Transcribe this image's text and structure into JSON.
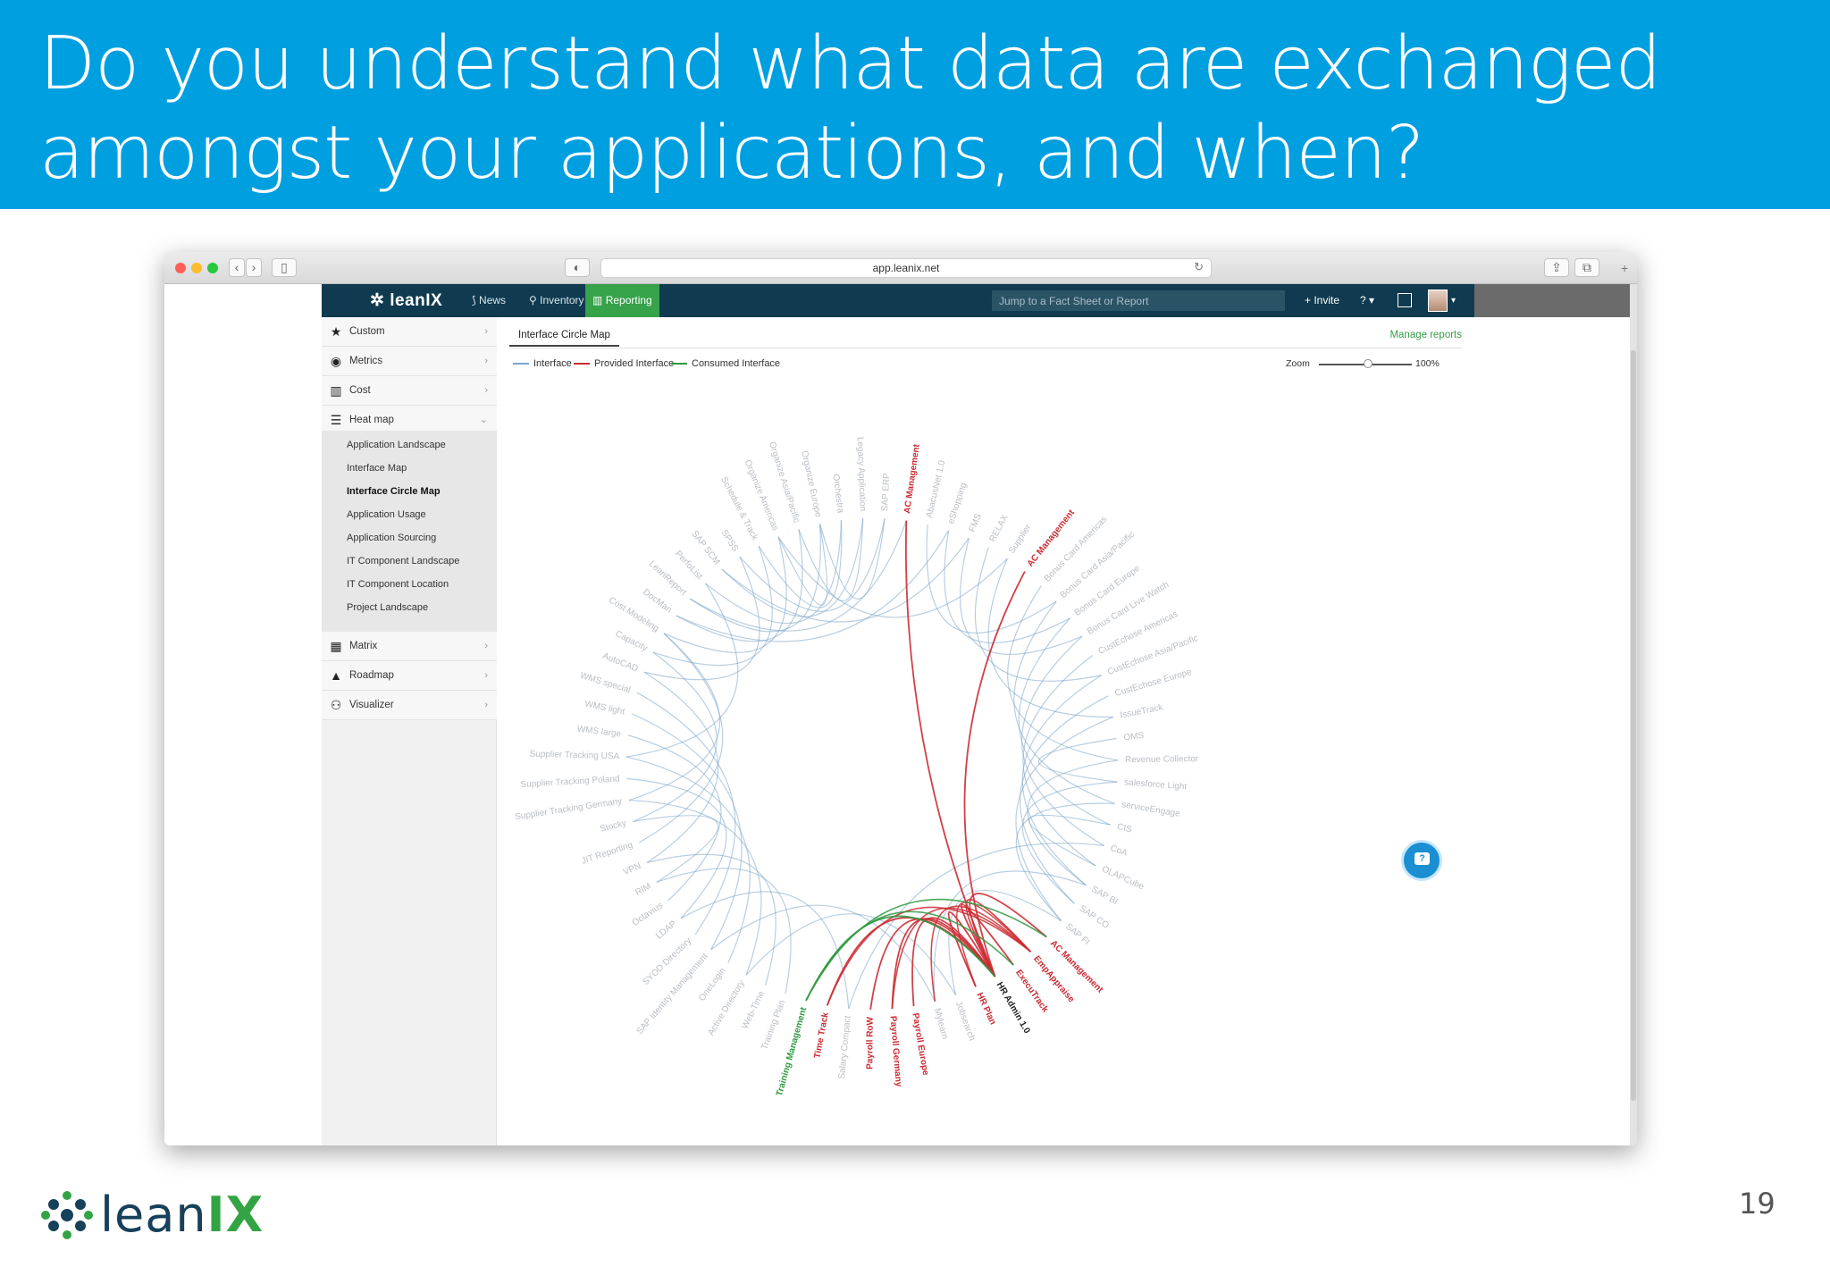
{
  "slide": {
    "title": "Do you understand what data are exchanged amongst your applications, and when?",
    "page_number": "19",
    "footer_logo_text_main": "lean",
    "footer_logo_text_accent": "IX"
  },
  "browser": {
    "url": "app.leanix.net"
  },
  "app": {
    "logo": "leanIX",
    "nav": [
      {
        "label": "News",
        "icon": "rss-icon"
      },
      {
        "label": "Inventory",
        "icon": "search-icon"
      },
      {
        "label": "Reporting",
        "icon": "bar-chart-icon",
        "active": true
      }
    ],
    "jump_placeholder": "Jump to a Fact Sheet or Report",
    "invite_label": "+ Invite",
    "help_label": "?",
    "colors": {
      "nav_bg": "#0f3a4f",
      "active_green": "#36a24a",
      "provided": "#cc2b33",
      "consumed": "#2e9a40",
      "interface": "#7ea6c9"
    }
  },
  "sidebar": {
    "items": [
      {
        "label": "Custom",
        "icon": "star-icon"
      },
      {
        "label": "Metrics",
        "icon": "dashboard-icon"
      },
      {
        "label": "Cost",
        "icon": "bar-chart-icon"
      },
      {
        "label": "Heat map",
        "icon": "list-icon",
        "expanded": true
      },
      {
        "label": "Matrix",
        "icon": "grid-icon"
      },
      {
        "label": "Roadmap",
        "icon": "roadmap-icon"
      },
      {
        "label": "Visualizer",
        "icon": "hierarchy-icon"
      }
    ],
    "heat_map_sub": [
      "Application Landscape",
      "Interface Map",
      "Interface Circle Map",
      "Application Usage",
      "Application Sourcing",
      "IT Component Landscape",
      "IT Component Location",
      "Project Landscape"
    ],
    "selected_sub": "Interface Circle Map"
  },
  "report": {
    "tab_label": "Interface Circle Map",
    "manage_reports": "Manage reports",
    "legend": [
      {
        "label": "Interface",
        "color": "#7ea6c9"
      },
      {
        "label": "Provided Interface",
        "color": "#cc2b33"
      },
      {
        "label": "Consumed Interface",
        "color": "#2e9a40"
      }
    ],
    "zoom_label": "Zoom",
    "zoom_value": "100%",
    "zoom_level": 0.5
  },
  "circle_map": {
    "labels": [
      {
        "text": "AC Management",
        "style": "red"
      },
      {
        "text": "AbacusNet 1.0",
        "style": "faint"
      },
      {
        "text": "eShopping",
        "style": "faint"
      },
      {
        "text": "FMS",
        "style": "faint"
      },
      {
        "text": "RELAX",
        "style": "faint"
      },
      {
        "text": "Supplier",
        "style": "faint"
      },
      {
        "text": "AC Management",
        "style": "red"
      },
      {
        "text": "Bonus Card Americas",
        "style": "faint"
      },
      {
        "text": "Bonus Card Asia/Pacific",
        "style": "faint"
      },
      {
        "text": "Bonus Card Europe",
        "style": "faint"
      },
      {
        "text": "Bonus Card Live Watch",
        "style": "faint"
      },
      {
        "text": "CustEchose Americas",
        "style": "faint"
      },
      {
        "text": "CustEchose Asia/Pacific",
        "style": "faint"
      },
      {
        "text": "CustEchose Europe",
        "style": "faint"
      },
      {
        "text": "IssueTrack",
        "style": "faint"
      },
      {
        "text": "OMS",
        "style": "faint"
      },
      {
        "text": "Revenue Collector",
        "style": "faint"
      },
      {
        "text": "salesforce Light",
        "style": "faint"
      },
      {
        "text": "serviceEngage",
        "style": "faint"
      },
      {
        "text": "CIS",
        "style": "faint"
      },
      {
        "text": "CoA",
        "style": "faint"
      },
      {
        "text": "OLAPCube",
        "style": "faint"
      },
      {
        "text": "SAP BI",
        "style": "faint"
      },
      {
        "text": "SAP CO",
        "style": "faint"
      },
      {
        "text": "SAP FI",
        "style": "faint"
      },
      {
        "text": "AC Management",
        "style": "red"
      },
      {
        "text": "EmpAppraise",
        "style": "red"
      },
      {
        "text": "ExecuTrack",
        "style": "red"
      },
      {
        "text": "HR Admin 1.0",
        "style": "black"
      },
      {
        "text": "HR Plan",
        "style": "red"
      },
      {
        "text": "Jobsearch",
        "style": "faint"
      },
      {
        "text": "Mylearn",
        "style": "faint"
      },
      {
        "text": "Payroll Europe",
        "style": "red"
      },
      {
        "text": "Payroll Germany",
        "style": "red"
      },
      {
        "text": "Payroll RoW",
        "style": "red"
      },
      {
        "text": "Salary Compact",
        "style": "faint"
      },
      {
        "text": "Time Track",
        "style": "red"
      },
      {
        "text": "Training Management",
        "style": "green"
      },
      {
        "text": "Training Plan",
        "style": "faint"
      },
      {
        "text": "Web-Time",
        "style": "faint"
      },
      {
        "text": "Active Directory",
        "style": "faint"
      },
      {
        "text": "OneLogin",
        "style": "faint"
      },
      {
        "text": "SAP Identity Management",
        "style": "faint"
      },
      {
        "text": "SYOD Directory",
        "style": "faint"
      },
      {
        "text": "LDAP",
        "style": "faint"
      },
      {
        "text": "Octavius",
        "style": "faint"
      },
      {
        "text": "RIM",
        "style": "faint"
      },
      {
        "text": "VPN",
        "style": "faint"
      },
      {
        "text": "JIT Reporting",
        "style": "faint"
      },
      {
        "text": "Stocky",
        "style": "faint"
      },
      {
        "text": "Supplier Tracking Germany",
        "style": "faint"
      },
      {
        "text": "Supplier Tracking Poland",
        "style": "faint"
      },
      {
        "text": "Supplier Tracking USA",
        "style": "faint"
      },
      {
        "text": "WMS large",
        "style": "faint"
      },
      {
        "text": "WMS light",
        "style": "faint"
      },
      {
        "text": "WMS special",
        "style": "faint"
      },
      {
        "text": "AutoCAD",
        "style": "faint"
      },
      {
        "text": "Capacity",
        "style": "faint"
      },
      {
        "text": "Cost Modeling",
        "style": "faint"
      },
      {
        "text": "DocMan",
        "style": "faint"
      },
      {
        "text": "LeanReport",
        "style": "faint"
      },
      {
        "text": "PerfoList",
        "style": "faint"
      },
      {
        "text": "SAP SCM",
        "style": "faint"
      },
      {
        "text": "SPSS",
        "style": "faint"
      },
      {
        "text": "Schedule & Track",
        "style": "faint"
      },
      {
        "text": "Organize Americas",
        "style": "faint"
      },
      {
        "text": "Organize Asia/Pacific",
        "style": "faint"
      },
      {
        "text": "Organize Europe",
        "style": "faint"
      },
      {
        "text": "Orchestra",
        "style": "faint"
      },
      {
        "text": "Legacy Application",
        "style": "faint"
      },
      {
        "text": "SAP ERP",
        "style": "faint"
      }
    ]
  }
}
